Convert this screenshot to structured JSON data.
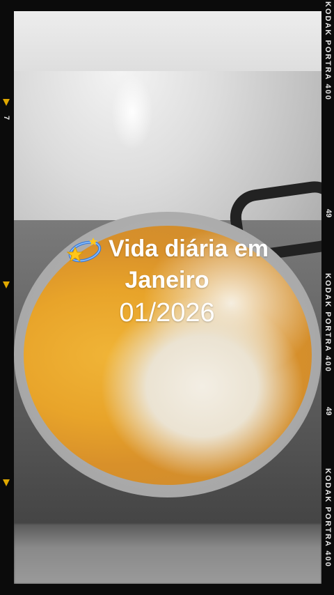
{
  "overlay": {
    "title_line1": "Vida diária em",
    "title_line2": "Janeiro",
    "date": "01/2026",
    "emoji_icon": "dizzy-star-icon"
  },
  "film_frame": {
    "brand_label": "KODAK PORTRA 400",
    "frame_number_right": "49",
    "frame_number_left": "7",
    "marker_color": "#e0a800"
  },
  "colors": {
    "background": "#0b0b0b",
    "text": "#ffffff",
    "rice_yellow": "#e8a42a",
    "rice_white": "#f3eee4"
  }
}
